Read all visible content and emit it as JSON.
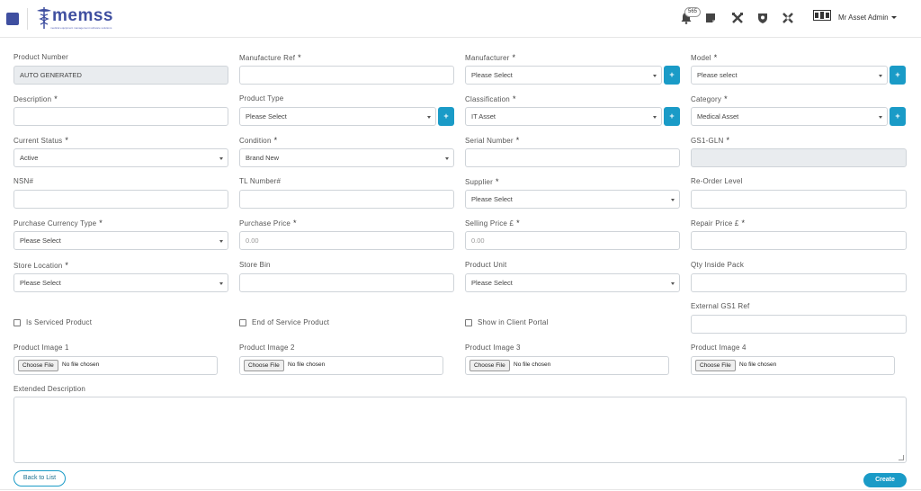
{
  "header": {
    "logo_text": "memss",
    "logo_subtext": "medical equipment management software solutions",
    "notification_count": "565",
    "user_name": "Mr Asset Admin"
  },
  "form": {
    "product_number": {
      "label": "Product Number",
      "value": "AUTO GENERATED"
    },
    "manufacture_ref": {
      "label": "Manufacture Ref",
      "value": ""
    },
    "manufacturer": {
      "label": "Manufacturer",
      "value": "Please Select"
    },
    "model": {
      "label": "Model",
      "value": "Please select"
    },
    "description": {
      "label": "Description",
      "value": ""
    },
    "product_type": {
      "label": "Product Type",
      "value": "Please Select"
    },
    "classification": {
      "label": "Classification",
      "value": "IT Asset"
    },
    "category": {
      "label": "Category",
      "value": "Medical Asset"
    },
    "current_status": {
      "label": "Current Status",
      "value": "Active"
    },
    "condition": {
      "label": "Condition",
      "value": "Brand New"
    },
    "serial_number": {
      "label": "Serial Number",
      "value": ""
    },
    "gs1_gln": {
      "label": "GS1-GLN",
      "value": ""
    },
    "nsn": {
      "label": "NSN#",
      "value": ""
    },
    "tl_number": {
      "label": "TL Number#",
      "value": ""
    },
    "supplier": {
      "label": "Supplier",
      "value": "Please Select"
    },
    "reorder_level": {
      "label": "Re-Order Level",
      "value": ""
    },
    "purchase_currency": {
      "label": "Purchase Currency Type",
      "value": "Please Select"
    },
    "purchase_price": {
      "label": "Purchase Price",
      "placeholder": "0.00"
    },
    "selling_price": {
      "label": "Selling Price £",
      "placeholder": "0.00"
    },
    "repair_price": {
      "label": "Repair Price £",
      "value": ""
    },
    "store_location": {
      "label": "Store Location",
      "value": "Please Select"
    },
    "store_bin": {
      "label": "Store Bin",
      "value": ""
    },
    "product_unit": {
      "label": "Product Unit",
      "value": "Please Select"
    },
    "qty_inside_pack": {
      "label": "Qty Inside Pack",
      "value": ""
    },
    "is_serviced": {
      "label": "Is Serviced Product"
    },
    "end_of_service": {
      "label": "End of Service Product"
    },
    "show_in_portal": {
      "label": "Show in Client Portal"
    },
    "external_gs1": {
      "label": "External GS1 Ref",
      "value": ""
    },
    "images": [
      {
        "label": "Product Image 1"
      },
      {
        "label": "Product Image 2"
      },
      {
        "label": "Product Image 3"
      },
      {
        "label": "Product Image 4"
      }
    ],
    "file_button": "Choose File",
    "file_status": "No file chosen",
    "extended_description": {
      "label": "Extended Description",
      "value": ""
    },
    "required_mark": "*",
    "plus_label": "+"
  },
  "actions": {
    "back_label": "Back to List",
    "create_label": "Create"
  },
  "colors": {
    "brand": "#3f4fa0",
    "accent": "#1a9bc7"
  }
}
